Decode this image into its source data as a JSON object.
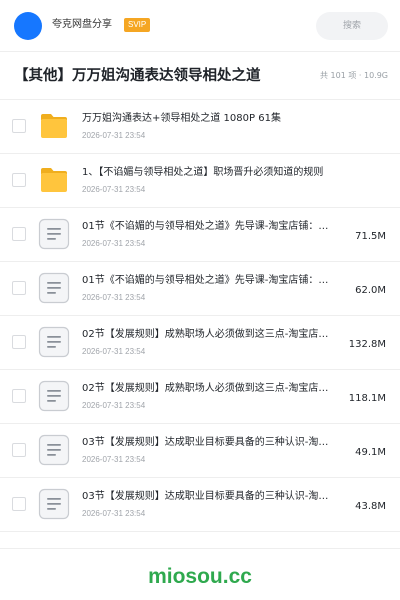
{
  "header": {
    "app_name": "夸克网盘分享",
    "badge": "SVIP",
    "search_placeholder": "搜索"
  },
  "folder": {
    "title": "【其他】万万姐沟通表达领导相处之道",
    "meta": "共 101 项 · 10.9G"
  },
  "files": [
    {
      "type": "folder",
      "name": "万万姐沟通表达+领导相处之道 1080P 61集",
      "date": "2026-07-31 23:54",
      "size": ""
    },
    {
      "type": "folder",
      "name": "1、【不谄媚与领导相处之道】职场晋升必须知道的规则",
      "date": "2026-07-31 23:54",
      "size": ""
    },
    {
      "type": "file",
      "name": "01节《不谄媚的与领导相处之道》先导课-淘宝店铺：…",
      "date": "2026-07-31 23:54",
      "size": "71.5M"
    },
    {
      "type": "file",
      "name": "01节《不谄媚的与领导相处之道》先导课-淘宝店铺：…",
      "date": "2026-07-31 23:54",
      "size": "62.0M"
    },
    {
      "type": "file",
      "name": "02节【发展规则】成熟职场人必须做到这三点-淘宝店…",
      "date": "2026-07-31 23:54",
      "size": "132.8M"
    },
    {
      "type": "file",
      "name": "02节【发展规则】成熟职场人必须做到这三点-淘宝店…",
      "date": "2026-07-31 23:54",
      "size": "118.1M"
    },
    {
      "type": "file",
      "name": "03节【发展规则】达成职业目标要具备的三种认识-淘…",
      "date": "2026-07-31 23:54",
      "size": "49.1M"
    },
    {
      "type": "file",
      "name": "03节【发展规则】达成职业目标要具备的三种认识-淘…",
      "date": "2026-07-31 23:54",
      "size": "43.8M"
    }
  ],
  "icons": {
    "folder": "folder-icon",
    "file": "document-icon",
    "folder_color": "#ffc53d",
    "file_color": "#8a9099"
  },
  "colors": {
    "accent": "#1677ff",
    "badge": "#f5a623",
    "watermark": "#2fa94e"
  },
  "watermark": "miosou.cc"
}
